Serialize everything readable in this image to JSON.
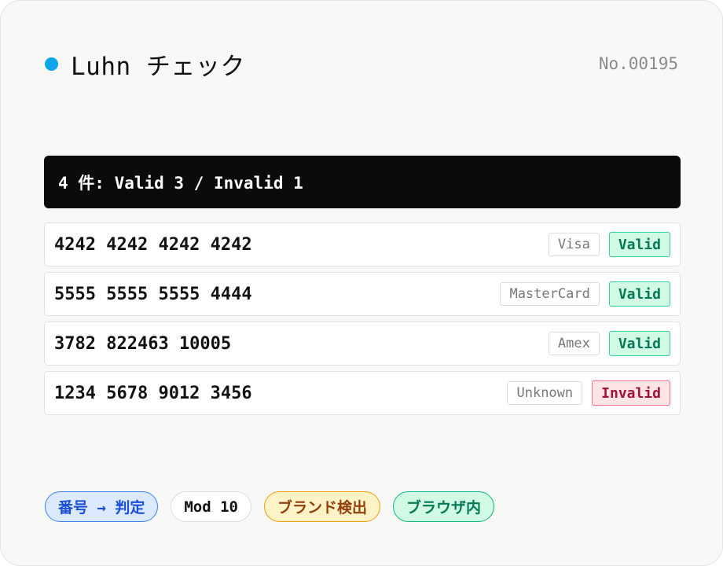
{
  "header": {
    "title": "Luhn チェック",
    "number": "No.00195",
    "dot_color": "#0ea5e9"
  },
  "summary": {
    "text": "4 件: Valid 3 / Invalid 1"
  },
  "rows": [
    {
      "number": "4242 4242 4242 4242",
      "brand": "Visa",
      "status": "Valid"
    },
    {
      "number": "5555 5555 5555 4444",
      "brand": "MasterCard",
      "status": "Valid"
    },
    {
      "number": "3782 822463 10005",
      "brand": "Amex",
      "status": "Valid"
    },
    {
      "number": "1234 5678 9012 3456",
      "brand": "Unknown",
      "status": "Invalid"
    }
  ],
  "tags": [
    {
      "label": "番号 → 判定"
    },
    {
      "label": "Mod 10"
    },
    {
      "label": "ブランド検出"
    },
    {
      "label": "ブラウザ内"
    }
  ],
  "colors": {
    "valid": "#047857",
    "invalid": "#9f1239",
    "summary_bg": "#0b0b0b"
  }
}
